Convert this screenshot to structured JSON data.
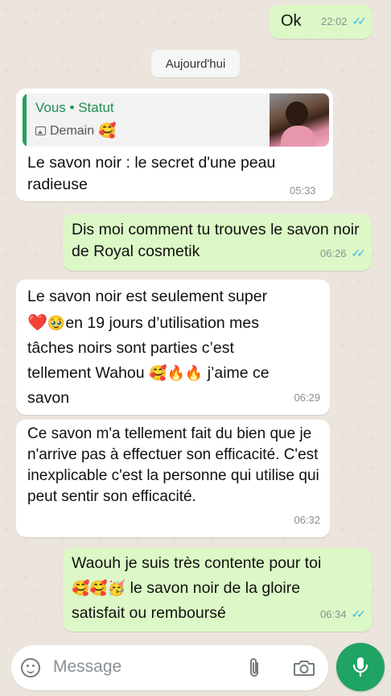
{
  "messages": [
    {
      "id": "m1",
      "dir": "out",
      "text": "Ok",
      "time": "22:02",
      "ticks": "✓✓"
    },
    {
      "id": "m2",
      "dir": "in",
      "quote_title": "Vous • Statut",
      "quote_sub": "Demain",
      "quote_emoji": "🥰",
      "text": "Le savon noir : le secret d'une peau radieuse",
      "time": "05:33"
    },
    {
      "id": "m3",
      "dir": "out",
      "text": "Dis moi comment tu trouves le savon noir de Royal cosmetik",
      "time": "06:26",
      "ticks": "✓✓"
    },
    {
      "id": "m4",
      "dir": "in",
      "line1": "Le savon noir est seulement super",
      "line2_emoji_a": "❤️",
      "line2_emoji_b": "🥹",
      "line2": "en 19 jours d’utilisation mes",
      "line3": "tâches noirs sont parties c’est",
      "line4_a": "tellement Wahou",
      "line4_emojis": "🥰🔥🔥",
      "line4_b": "j’aime ce",
      "line5": "savon",
      "time": "06:29"
    },
    {
      "id": "m5",
      "dir": "in",
      "text": "Ce savon m'a tellement  fait du bien que je n'arrive pas à effectuer son efficacité. C'est inexplicable c'est la personne qui utilise qui peut sentir son efficacité.",
      "time": "06:32"
    },
    {
      "id": "m6",
      "dir": "out",
      "line1": "Waouh je suis très contente pour toi",
      "line2_emojis": "🥰🥰🥳",
      "line2": "le savon noir de la gloire",
      "line3": "satisfait ou remboursé",
      "time": "06:34",
      "ticks": "✓✓"
    }
  ],
  "day_separator": "Aujourd'hui",
  "composer": {
    "placeholder": "Message",
    "emoji_icon": "smiley-icon",
    "attach_icon": "paperclip-icon",
    "camera_icon": "camera-icon",
    "mic_icon": "microphone-icon"
  },
  "colors": {
    "background": "#ece5dd",
    "incoming": "#ffffff",
    "outgoing": "#dcf8c6",
    "accent": "#1fa463",
    "read_ticks": "#34b7f1"
  }
}
